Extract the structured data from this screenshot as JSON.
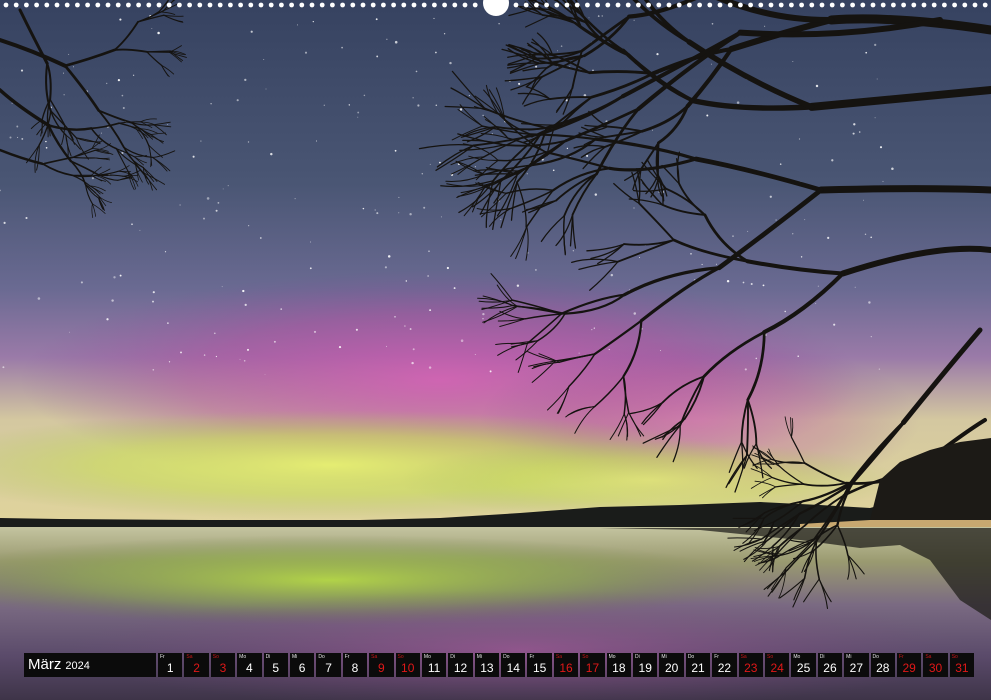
{
  "calendar": {
    "month": "März",
    "year": "2024",
    "days": [
      {
        "wd": "Fr",
        "n": "1",
        "red": false
      },
      {
        "wd": "Sa",
        "n": "2",
        "red": true
      },
      {
        "wd": "So",
        "n": "3",
        "red": true
      },
      {
        "wd": "Mo",
        "n": "4",
        "red": false
      },
      {
        "wd": "Di",
        "n": "5",
        "red": false
      },
      {
        "wd": "Mi",
        "n": "6",
        "red": false
      },
      {
        "wd": "Do",
        "n": "7",
        "red": false
      },
      {
        "wd": "Fr",
        "n": "8",
        "red": false
      },
      {
        "wd": "Sa",
        "n": "9",
        "red": true
      },
      {
        "wd": "So",
        "n": "10",
        "red": true
      },
      {
        "wd": "Mo",
        "n": "11",
        "red": false
      },
      {
        "wd": "Di",
        "n": "12",
        "red": false
      },
      {
        "wd": "Mi",
        "n": "13",
        "red": false
      },
      {
        "wd": "Do",
        "n": "14",
        "red": false
      },
      {
        "wd": "Fr",
        "n": "15",
        "red": false
      },
      {
        "wd": "Sa",
        "n": "16",
        "red": true
      },
      {
        "wd": "So",
        "n": "17",
        "red": true
      },
      {
        "wd": "Mo",
        "n": "18",
        "red": false
      },
      {
        "wd": "Di",
        "n": "19",
        "red": false
      },
      {
        "wd": "Mi",
        "n": "20",
        "red": false
      },
      {
        "wd": "Do",
        "n": "21",
        "red": false
      },
      {
        "wd": "Fr",
        "n": "22",
        "red": false
      },
      {
        "wd": "Sa",
        "n": "23",
        "red": true
      },
      {
        "wd": "So",
        "n": "24",
        "red": true
      },
      {
        "wd": "Mo",
        "n": "25",
        "red": false
      },
      {
        "wd": "Di",
        "n": "26",
        "red": false
      },
      {
        "wd": "Mi",
        "n": "27",
        "red": false
      },
      {
        "wd": "Do",
        "n": "28",
        "red": false
      },
      {
        "wd": "Fr",
        "n": "29",
        "red": true
      },
      {
        "wd": "Sa",
        "n": "30",
        "red": true
      },
      {
        "wd": "So",
        "n": "31",
        "red": true
      }
    ]
  },
  "colors": {
    "sky_top": "#3a4662",
    "aurora_pink": "#c25aa8",
    "aurora_green": "#c8e25a",
    "water": "#3e3a4c",
    "silhouette": "#141210",
    "calendar_bg": "#0b0b0b",
    "weekend_red": "#e01818"
  }
}
